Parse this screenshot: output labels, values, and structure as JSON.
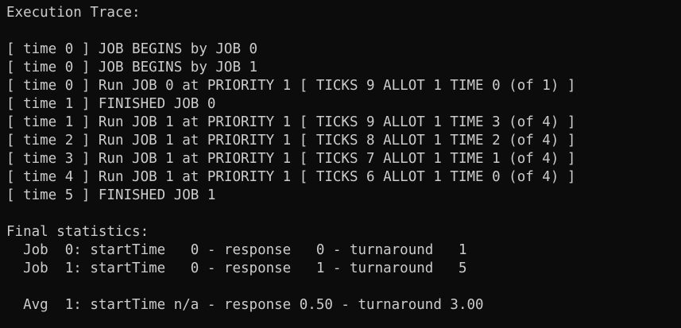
{
  "terminal": {
    "lines": [
      "Execution Trace:",
      "",
      "[ time 0 ] JOB BEGINS by JOB 0",
      "[ time 0 ] JOB BEGINS by JOB 1",
      "[ time 0 ] Run JOB 0 at PRIORITY 1 [ TICKS 9 ALLOT 1 TIME 0 (of 1) ]",
      "[ time 1 ] FINISHED JOB 0",
      "[ time 1 ] Run JOB 1 at PRIORITY 1 [ TICKS 9 ALLOT 1 TIME 3 (of 4) ]",
      "[ time 2 ] Run JOB 1 at PRIORITY 1 [ TICKS 8 ALLOT 1 TIME 2 (of 4) ]",
      "[ time 3 ] Run JOB 1 at PRIORITY 1 [ TICKS 7 ALLOT 1 TIME 1 (of 4) ]",
      "[ time 4 ] Run JOB 1 at PRIORITY 1 [ TICKS 6 ALLOT 1 TIME 0 (of 4) ]",
      "[ time 5 ] FINISHED JOB 1",
      "",
      "Final statistics:",
      "  Job  0: startTime   0 - response   0 - turnaround   1",
      "  Job  1: startTime   0 - response   1 - turnaround   5",
      "",
      "  Avg  1: startTime n/a - response 0.50 - turnaround 3.00"
    ]
  }
}
